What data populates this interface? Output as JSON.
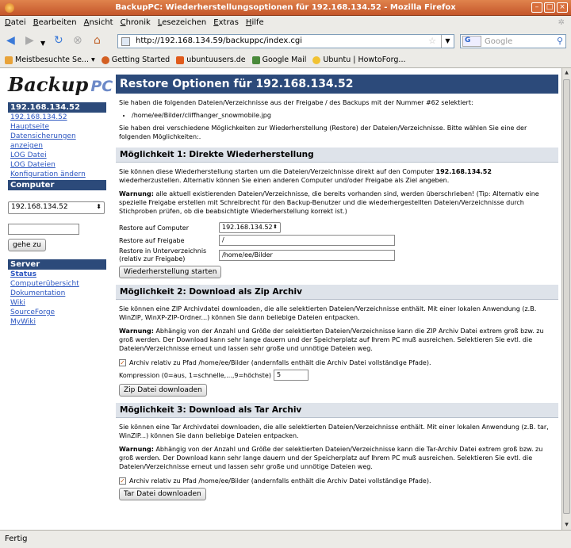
{
  "window": {
    "title": "BackupPC: Wiederherstellungsoptionen für 192.168.134.52 - Mozilla Firefox",
    "buttons": [
      "–",
      "□",
      "×"
    ]
  },
  "menu": [
    {
      "u": "D",
      "rest": "atei"
    },
    {
      "u": "B",
      "rest": "earbeiten"
    },
    {
      "u": "A",
      "rest": "nsicht"
    },
    {
      "u": "C",
      "rest": "hronik"
    },
    {
      "u": "L",
      "rest": "esezeichen"
    },
    {
      "u": "E",
      "rest": "xtras"
    },
    {
      "u": "H",
      "rest": "ilfe"
    }
  ],
  "navigation": {
    "url": "http://192.168.134.59/backuppc/index.cgi",
    "search_placeholder": "Google",
    "search_engine": "G"
  },
  "bookmarks": [
    {
      "label": "Meistbesuchte Se...",
      "icon": "folder-icon",
      "color": "#e8a33a"
    },
    {
      "label": "Getting Started",
      "icon": "firefox-icon",
      "color": "#d35f22"
    },
    {
      "label": "ubuntuusers.de",
      "icon": "ubuntuusers-icon",
      "color": "#e05b1c"
    },
    {
      "label": "Google Mail",
      "icon": "google-mail-icon",
      "color": "#4a8a3b"
    },
    {
      "label": "Ubuntu | HowtoForg...",
      "icon": "lightbulb-icon",
      "color": "#f1c232"
    }
  ],
  "sidebar": {
    "logo_main": "Backup",
    "logo_accent": "PC",
    "host_header": "192.168.134.52",
    "host_links": [
      "192.168.134.52 Hauptseite",
      "Datensicherungen anzeigen",
      "LOG Datei",
      "LOG Dateien",
      "Konfiguration ändern"
    ],
    "computer_header": "Computer",
    "computer_select": "192.168.134.52",
    "goto_button": "gehe zu",
    "server_header": "Server",
    "server_links": [
      "Status",
      "Computerübersicht",
      "Dokumentation",
      "Wiki",
      "SourceForge",
      "MyWiki"
    ]
  },
  "main": {
    "heading": "Restore Optionen für 192.168.134.52",
    "intro": "Sie haben die folgenden Dateien/Verzeichnisse aus der Freigabe / des Backups mit der Nummer #62 selektiert:",
    "file": "/home/ee/Bilder/cliffhanger_snowmobile.jpg",
    "choice_text": "Sie haben drei verschiedene Möglichkeiten zur Wiederherstellung (Restore) der Dateien/Verzeichnisse. Bitte wählen Sie eine der folgenden Möglichkeiten:.",
    "opt1": {
      "heading": "Möglichkeit 1: Direkte Wiederherstellung",
      "desc_a": "Sie können diese Wiederherstellung starten um die Dateien/Verzeichnisse direkt auf den Computer ",
      "desc_host": "192.168.134.52",
      "desc_b": " wiederherzustellen. Alternativ können Sie einen anderen Computer und/oder Freigabe als Ziel angeben.",
      "warn_label": "Warnung:",
      "warn_text": " alle aktuell existierenden Dateien/Verzeichnisse, die bereits vorhanden sind, werden überschrieben! (Tip: Alternativ eine spezielle Freigabe erstellen mit Schreibrecht für den Backup-Benutzer und die wiederhergestellten Dateien/Verzeichnisse durch Stichproben prüfen, ob die beabsichtigte Wiederherstellung korrekt ist.)",
      "label_computer": "Restore auf Computer",
      "value_computer": "192.168.134.52",
      "label_share": "Restore auf Freigabe",
      "value_share": "/",
      "label_dir_1": "Restore in Unterverzeichnis",
      "label_dir_2": "(relativ zur Freigabe)",
      "value_dir": "/home/ee/Bilder",
      "button": "Wiederherstellung starten"
    },
    "opt2": {
      "heading": "Möglichkeit 2: Download als Zip Archiv",
      "desc": "Sie können eine ZIP Archivdatei downloaden, die alle selektierten Dateien/Verzeichnisse enthält. Mit einer lokalen Anwendung (z.B. WinZIP, WinXP-ZIP-Ordner...) können Sie dann beliebige Dateien entpacken.",
      "warn_label": "Warnung:",
      "warn_text": " Abhängig von der Anzahl und Größe der selektierten Dateien/Verzeichnisse kann die ZIP Archiv Datei extrem groß bzw. zu groß werden. Der Download kann sehr lange dauern und der Speicherplatz auf Ihrem PC muß ausreichen. Selektieren Sie evtl. die Dateien/Verzeichnisse erneut und lassen sehr große und unnötige Dateien weg.",
      "checkbox": "Archiv relativ zu Pfad /home/ee/Bilder (andernfalls enthält die Archiv Datei vollständige Pfade).",
      "komp_label": "Kompression (0=aus, 1=schnelle,...,9=höchste)",
      "komp_value": "5",
      "button": "Zip Datei downloaden"
    },
    "opt3": {
      "heading": "Möglichkeit 3: Download als Tar Archiv",
      "desc": "Sie können eine Tar Archivdatei downloaden, die alle selektierten Dateien/Verzeichnisse enthält. Mit einer lokalen Anwendung (z.B. tar, WinZIP...) können Sie dann beliebige Dateien entpacken.",
      "warn_label": "Warnung:",
      "warn_text": " Abhängig von der Anzahl und Größe der selektierten Dateien/Verzeichnisse kann die Tar-Archiv Datei extrem groß bzw. zu groß werden. Der Download kann sehr lange dauern und der Speicherplatz auf Ihrem PC muß ausreichen. Selektieren Sie evtl. die Dateien/Verzeichnisse erneut und lassen sehr große und unnötige Dateien weg.",
      "checkbox": "Archiv relativ zu Pfad /home/ee/Bilder (andernfalls enthält die Archiv Datei vollständige Pfade).",
      "button": "Tar Datei downloaden"
    }
  },
  "status": "Fertig"
}
